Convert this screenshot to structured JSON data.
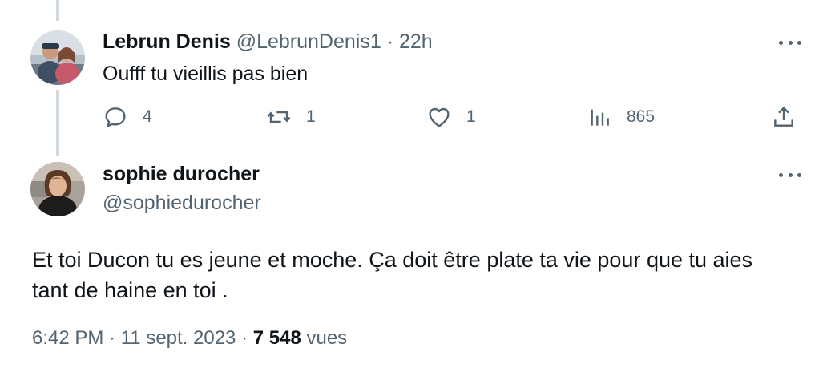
{
  "reply": {
    "author_name": "Lebrun Denis",
    "handle": "@LebrunDenis1",
    "separator": "·",
    "time": "22h",
    "text": "Oufff tu vieillis pas bien",
    "actions": {
      "replies": "4",
      "reposts": "1",
      "likes": "1",
      "views": "865"
    }
  },
  "tweet": {
    "author_name": "sophie durocher",
    "handle": "@sophiedurocher",
    "text_line1": "Et toi Ducon tu es jeune et moche. Ça doit être plate ta vie pour que tu aies",
    "text_line2": "tant de haine en toi .",
    "time": "6:42 PM",
    "separator": "·",
    "date": "11 sept. 2023",
    "views_count": "7 548",
    "views_label": "vues"
  },
  "icons": {
    "reply": "speech-bubble-icon",
    "repost": "repost-arrows-icon",
    "like": "heart-icon",
    "views": "bar-chart-icon",
    "share": "share-upload-icon",
    "more": "more-dots-icon"
  },
  "colors": {
    "text_primary": "#0f1419",
    "text_secondary": "#536471",
    "thread_line": "#cfd9de"
  }
}
